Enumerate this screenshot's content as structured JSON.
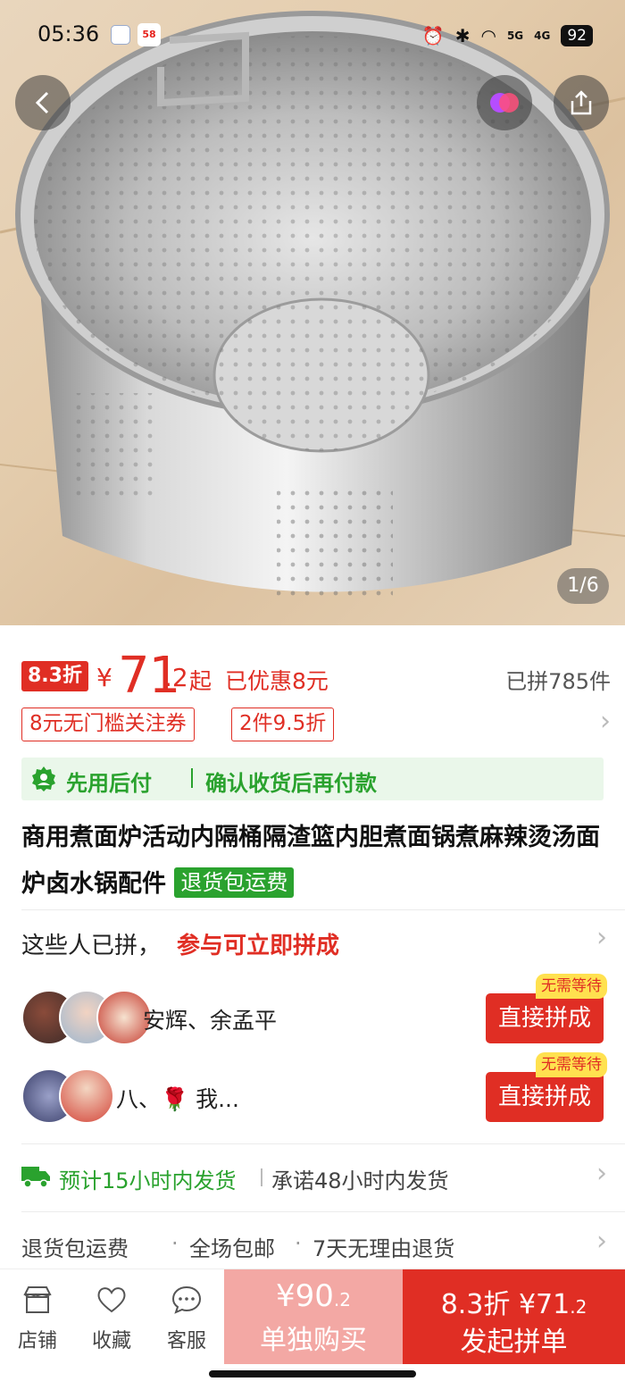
{
  "status_bar": {
    "time": "05:36",
    "app2_label": "58",
    "net1": "5G",
    "net2": "4G",
    "battery": "92"
  },
  "gallery": {
    "counter": "1/6"
  },
  "price": {
    "discount_tag": "8.3折",
    "currency": "¥",
    "integer": "71",
    "decimal": ".2",
    "from": "起",
    "saved": "已优惠8元",
    "sold": "已拼785件"
  },
  "coupons": [
    "8元无门槛关注券",
    "2件9.5折"
  ],
  "pay_later": {
    "title": "先用后付",
    "desc": "确认收货后再付款"
  },
  "product": {
    "title": "商用煮面炉活动内隔桶隔渣篮内胆煮面锅煮麻辣烫汤面炉卤水锅配件",
    "badge": "退货包运费"
  },
  "group": {
    "head": "这些人已拼，",
    "cta": "参与可立即拼成",
    "rows": [
      {
        "names": "安辉、余孟平",
        "tag": "无需等待",
        "button": "直接拼成"
      },
      {
        "names": "八、🌹 我...",
        "tag": "无需等待",
        "button": "直接拼成"
      }
    ]
  },
  "shipping": {
    "estimate": "预计15小时内发货",
    "promise": "承诺48小时内发货"
  },
  "services": [
    "退货包运费",
    "·",
    "全场包邮",
    "·",
    "7天无理由退货"
  ],
  "bottom_bar": {
    "store": "店铺",
    "favorite": "收藏",
    "service": "客服",
    "single": {
      "price": "¥90",
      "price_dec": ".2",
      "label": "单独购买"
    },
    "group": {
      "discount": "8.3折",
      "price": "¥71",
      "price_dec": ".2",
      "label": "发起拼单"
    }
  },
  "colors": {
    "accent": "#e02e24",
    "green": "#2aa22e",
    "light_red": "#f3a8a4"
  }
}
